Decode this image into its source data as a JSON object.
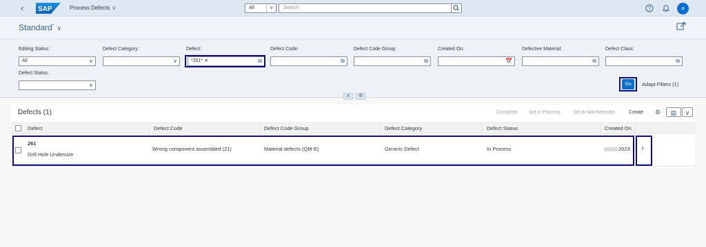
{
  "shell": {
    "app_title": "Process Defects",
    "scope_value": "All",
    "search_placeholder": "Search",
    "avatar_initial": "a"
  },
  "variant": {
    "name": "Standard",
    "modified_marker": "*"
  },
  "filters": {
    "editing_status": {
      "label": "Editing Status:",
      "value": "All"
    },
    "defect_category": {
      "label": "Defect Category:",
      "value": ""
    },
    "defect": {
      "label": "Defect:",
      "token": "*261*"
    },
    "defect_code": {
      "label": "Defect Code:",
      "value": ""
    },
    "defect_code_group": {
      "label": "Defect Code Group:",
      "value": ""
    },
    "created_on": {
      "label": "Created On:",
      "value": ""
    },
    "defective_material": {
      "label": "Defective Material:",
      "value": ""
    },
    "defect_class": {
      "label": "Defect Class:",
      "value": ""
    },
    "defect_status": {
      "label": "Defect Status:",
      "value": ""
    },
    "go_label": "Go",
    "adapt_label": "Adapt Filters (1)"
  },
  "table": {
    "title": "Defects (1)",
    "actions": {
      "complete": "Complete",
      "set_in_process": "Set in Process",
      "set_not_relevant": "Set to Not Relevant",
      "create": "Create"
    },
    "columns": {
      "defect": "Defect",
      "code": "Defect Code",
      "group": "Defect Code Group",
      "category": "Defect Category",
      "status": "Defect Status",
      "created": "Created On"
    },
    "row": {
      "id": "261",
      "description": "Drill Hole Undersize",
      "code": "Wrong component assembled (21)",
      "group": "Material defects (QM-E)",
      "category": "Generic Defect",
      "status": "In Process",
      "created_year": "2023"
    }
  },
  "colors": {
    "shell_bg": "#dde8f3",
    "accent": "#0a6ed1",
    "highlight_box": "#0b0b7a",
    "link": "#346187"
  }
}
